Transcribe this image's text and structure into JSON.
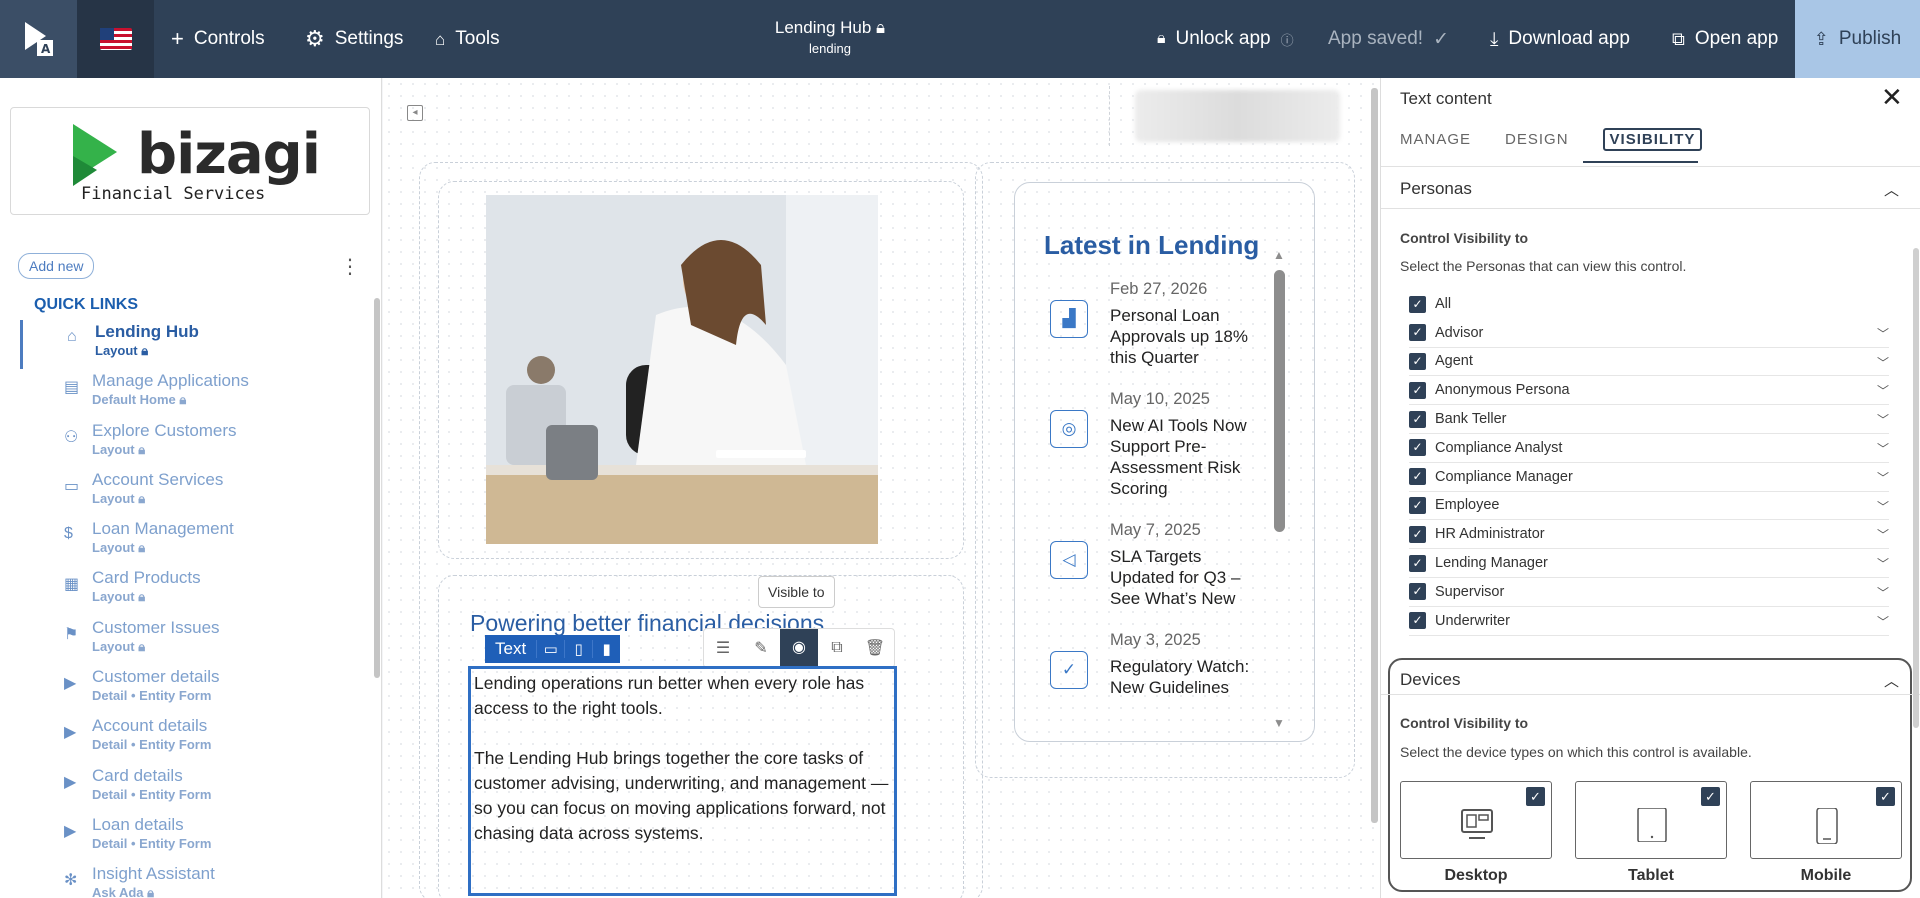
{
  "topbar": {
    "controls": "Controls",
    "settings": "Settings",
    "tools": "Tools",
    "app_title": "Lending Hub",
    "app_sub": "lending",
    "unlock": "Unlock app",
    "saved": "App saved!",
    "download": "Download app",
    "open": "Open app",
    "publish": "Publish"
  },
  "sidebar": {
    "brand_name": "bizagi",
    "brand_sub": "Financial Services",
    "add_new": "Add new",
    "quick_links": "QUICK LINKS",
    "items": [
      {
        "label": "Lending Hub",
        "sub": "Layout",
        "icon": "home-icon",
        "glyph": "⌂"
      },
      {
        "label": "Manage Applications",
        "sub": "Default Home",
        "icon": "applications-icon",
        "glyph": "▤"
      },
      {
        "label": "Explore Customers",
        "sub": "Layout",
        "icon": "customers-icon",
        "glyph": "⚇"
      },
      {
        "label": "Account Services",
        "sub": "Layout",
        "icon": "account-icon",
        "glyph": "▭"
      },
      {
        "label": "Loan Management",
        "sub": "Layout",
        "icon": "dollar-icon",
        "glyph": "$"
      },
      {
        "label": "Card Products",
        "sub": "Layout",
        "icon": "card-icon",
        "glyph": "▦"
      },
      {
        "label": "Customer Issues",
        "sub": "Layout",
        "icon": "issues-icon",
        "glyph": "⚑"
      },
      {
        "label": "Customer details",
        "sub": "Detail • Entity Form",
        "icon": "form-icon",
        "glyph": "▶"
      },
      {
        "label": "Account details",
        "sub": "Detail • Entity Form",
        "icon": "form-icon",
        "glyph": "▶"
      },
      {
        "label": "Card details",
        "sub": "Detail • Entity Form",
        "icon": "form-icon",
        "glyph": "▶"
      },
      {
        "label": "Loan details",
        "sub": "Detail • Entity Form",
        "icon": "form-icon",
        "glyph": "▶"
      },
      {
        "label": "Insight Assistant",
        "sub": "Ask Ada",
        "icon": "assistant-icon",
        "glyph": "✻"
      }
    ]
  },
  "canvas": {
    "heading": "Powering better financial decisions",
    "selection_tag": "Text",
    "tooltip": "Visible to",
    "paragraph1": "Lending operations run better when every role has access to the right tools.",
    "paragraph2": "The Lending Hub brings together the core tasks of customer advising, underwriting, and management — so you can focus on moving applications forward, not chasing data across systems.",
    "news_title": "Latest in Lending",
    "news": [
      {
        "date": "Feb 27, 2026",
        "title": "Personal Loan Approvals up 18% this Quarter",
        "icon": "chart-icon",
        "glyph": "▟"
      },
      {
        "date": "May 10, 2025",
        "title": "New AI Tools Now Support Pre-Assessment Risk Scoring",
        "icon": "brain-icon",
        "glyph": "◎"
      },
      {
        "date": "May 7, 2025",
        "title": "SLA Targets Updated for Q3 – See What’s New",
        "icon": "megaphone-icon",
        "glyph": "◁"
      },
      {
        "date": "May 3, 2025",
        "title": "Regulatory Watch: New Guidelines",
        "icon": "checklist-icon",
        "glyph": "✓"
      }
    ]
  },
  "panel": {
    "title": "Text content",
    "tabs": [
      "MANAGE",
      "DESIGN",
      "VISIBILITY"
    ],
    "personas_header": "Personas",
    "personas_cv": "Control Visibility to",
    "personas_desc": "Select the Personas that can view this control.",
    "personas": [
      "All",
      "Advisor",
      "Agent",
      "Anonymous Persona",
      "Bank Teller",
      "Compliance Analyst",
      "Compliance Manager",
      "Employee",
      "HR Administrator",
      "Lending Manager",
      "Supervisor",
      "Underwriter"
    ],
    "devices_header": "Devices",
    "devices_cv": "Control Visibility to",
    "devices_desc": "Select the device types on which this control is available.",
    "devices": [
      "Desktop",
      "Tablet",
      "Mobile"
    ]
  }
}
